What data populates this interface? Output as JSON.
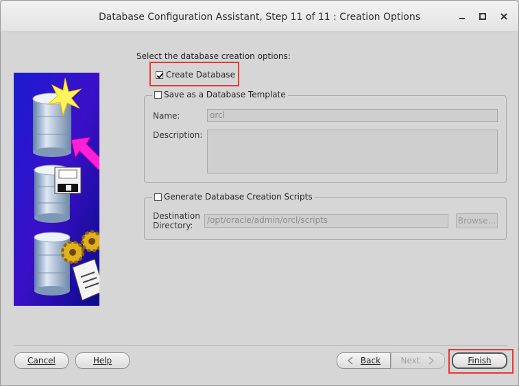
{
  "window": {
    "title": "Database Configuration Assistant, Step 11 of 11 : Creation Options"
  },
  "main": {
    "prompt": "Select the database creation options:",
    "create_database": {
      "label": "Create Database",
      "checked": true
    },
    "template_group": {
      "label": "Save as a Database Template",
      "checked": false,
      "name_label": "Name:",
      "name_value": "orcl",
      "description_label": "Description:",
      "description_value": ""
    },
    "scripts_group": {
      "label": "Generate Database Creation Scripts",
      "checked": false,
      "destination_label_1": "Destination",
      "destination_label_2": "Directory:",
      "destination_value": "/opt/oracle/admin/orcl/scripts",
      "browse_label": "Browse..."
    }
  },
  "footer": {
    "cancel_label": "Cancel",
    "help_label": "Help",
    "back_label": "Back",
    "next_label": "Next",
    "finish_label": "Finish"
  },
  "colors": {
    "highlight": "#e53935",
    "graphic_bg_top": "#1010b8",
    "graphic_bg_bottom": "#0a0a90"
  }
}
